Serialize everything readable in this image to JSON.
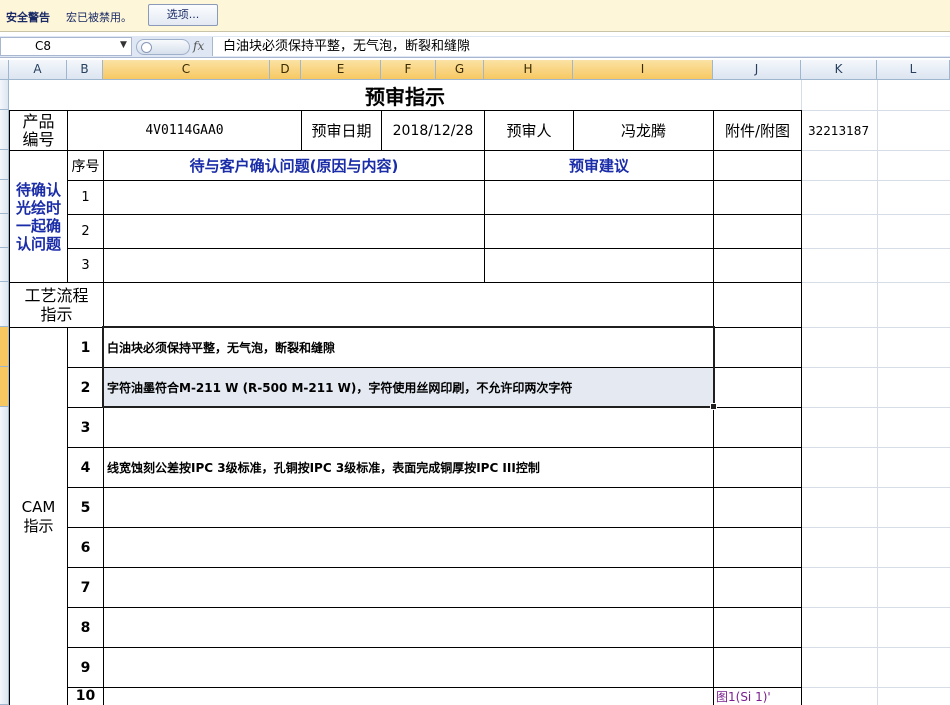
{
  "security_bar": {
    "title": "安全警告",
    "message": "宏已被禁用。",
    "options_button": "选项..."
  },
  "formula_bar": {
    "name_box": "C8",
    "fx_label": "fx",
    "content": "白油块必须保持平整，无气泡，断裂和缝隙"
  },
  "columns": [
    "A",
    "B",
    "C",
    "D",
    "E",
    "F",
    "G",
    "H",
    "I",
    "J",
    "K",
    "L"
  ],
  "sheet": {
    "title": "预审指示",
    "product_code_label": "产品编号",
    "product_code": "4V0114GAA0",
    "review_date_label": "预审日期",
    "review_date": "2018/12/28",
    "reviewer_label": "预审人",
    "reviewer": "冯龙腾",
    "attachment_label": "附件/附图",
    "side_number": "32213187",
    "seq_header": "序号",
    "issue_header": "待与客户确认问题(原因与内容)",
    "advice_header": "预审建议",
    "confirm_section_label": "待确认光绘时一起确认问题",
    "confirm_rows": [
      "1",
      "2",
      "3"
    ],
    "process_label": "工艺流程指示",
    "cam_label": "CAM指示",
    "cam_rows": [
      {
        "no": "1",
        "text": "白油块必须保持平整，无气泡，断裂和缝隙"
      },
      {
        "no": "2",
        "text": "字符油墨符合M-211 W (R-500 M-211 W)，字符使用丝网印刷，不允许印两次字符"
      },
      {
        "no": "3",
        "text": ""
      },
      {
        "no": "4",
        "text": "线宽蚀刻公差按IPC 3级标准，孔铜按IPC 3级标准，表面完成铜厚按IPC III控制"
      },
      {
        "no": "5",
        "text": ""
      },
      {
        "no": "6",
        "text": ""
      },
      {
        "no": "7",
        "text": ""
      },
      {
        "no": "8",
        "text": ""
      },
      {
        "no": "9",
        "text": ""
      },
      {
        "no": "10",
        "text": ""
      }
    ],
    "partial_link": "图1(Si 1)'"
  },
  "colors": {
    "accent_blue": "#1a2ca8",
    "selected_header": "#f7c862",
    "selected_fill": "#e4e9f2"
  }
}
